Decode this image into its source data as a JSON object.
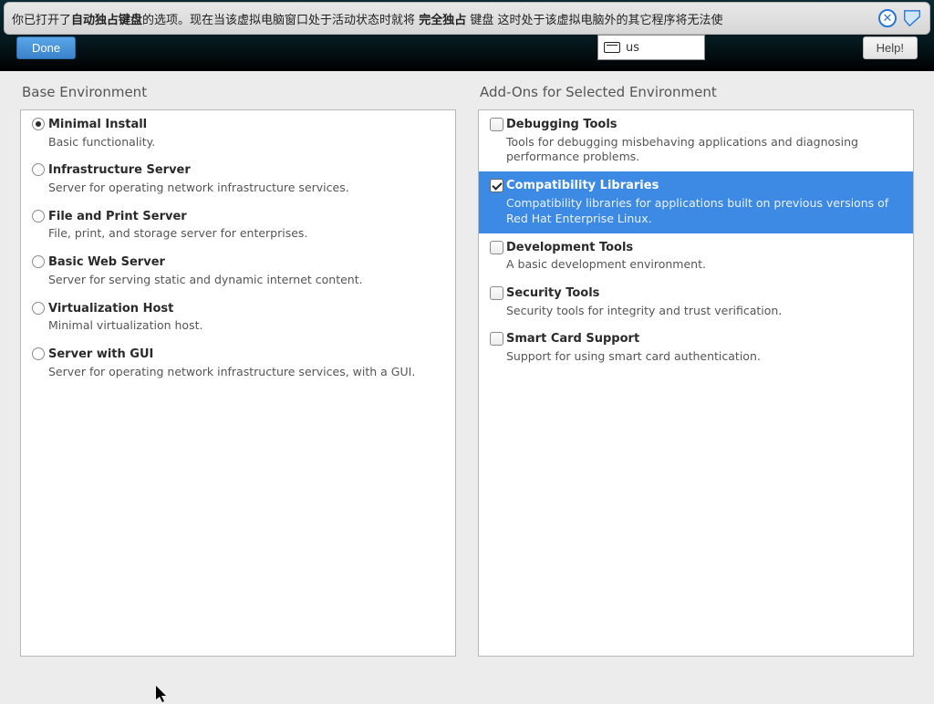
{
  "vm_banner": {
    "t1": "你已打开了",
    "b1": "自动独占键盘",
    "t2": "的选项。现在当该虚拟电脑窗口处于活动状态时就将",
    "b2": "完全独占",
    "t3": "键盘",
    "t4": "这时处于该虚拟电脑外的其它程序将无法使"
  },
  "buttons": {
    "done": "Done",
    "help": "Help!"
  },
  "kb": {
    "layout": "us"
  },
  "left": {
    "title": "Base Environment",
    "items": [
      {
        "title": "Minimal Install",
        "desc": "Basic functionality.",
        "checked": true
      },
      {
        "title": "Infrastructure Server",
        "desc": "Server for operating network infrastructure services.",
        "checked": false
      },
      {
        "title": "File and Print Server",
        "desc": "File, print, and storage server for enterprises.",
        "checked": false
      },
      {
        "title": "Basic Web Server",
        "desc": "Server for serving static and dynamic internet content.",
        "checked": false
      },
      {
        "title": "Virtualization Host",
        "desc": "Minimal virtualization host.",
        "checked": false
      },
      {
        "title": "Server with GUI",
        "desc": "Server for operating network infrastructure services, with a GUI.",
        "checked": false
      }
    ]
  },
  "right": {
    "title": "Add-Ons for Selected Environment",
    "items": [
      {
        "title": "Debugging Tools",
        "desc": "Tools for debugging misbehaving applications and diagnosing performance problems.",
        "checked": false,
        "selected": false
      },
      {
        "title": "Compatibility Libraries",
        "desc": "Compatibility libraries for applications built on previous versions of Red Hat Enterprise Linux.",
        "checked": true,
        "selected": true
      },
      {
        "title": "Development Tools",
        "desc": "A basic development environment.",
        "checked": false,
        "selected": false
      },
      {
        "title": "Security Tools",
        "desc": "Security tools for integrity and trust verification.",
        "checked": false,
        "selected": false
      },
      {
        "title": "Smart Card Support",
        "desc": "Support for using smart card authentication.",
        "checked": false,
        "selected": false
      }
    ]
  }
}
